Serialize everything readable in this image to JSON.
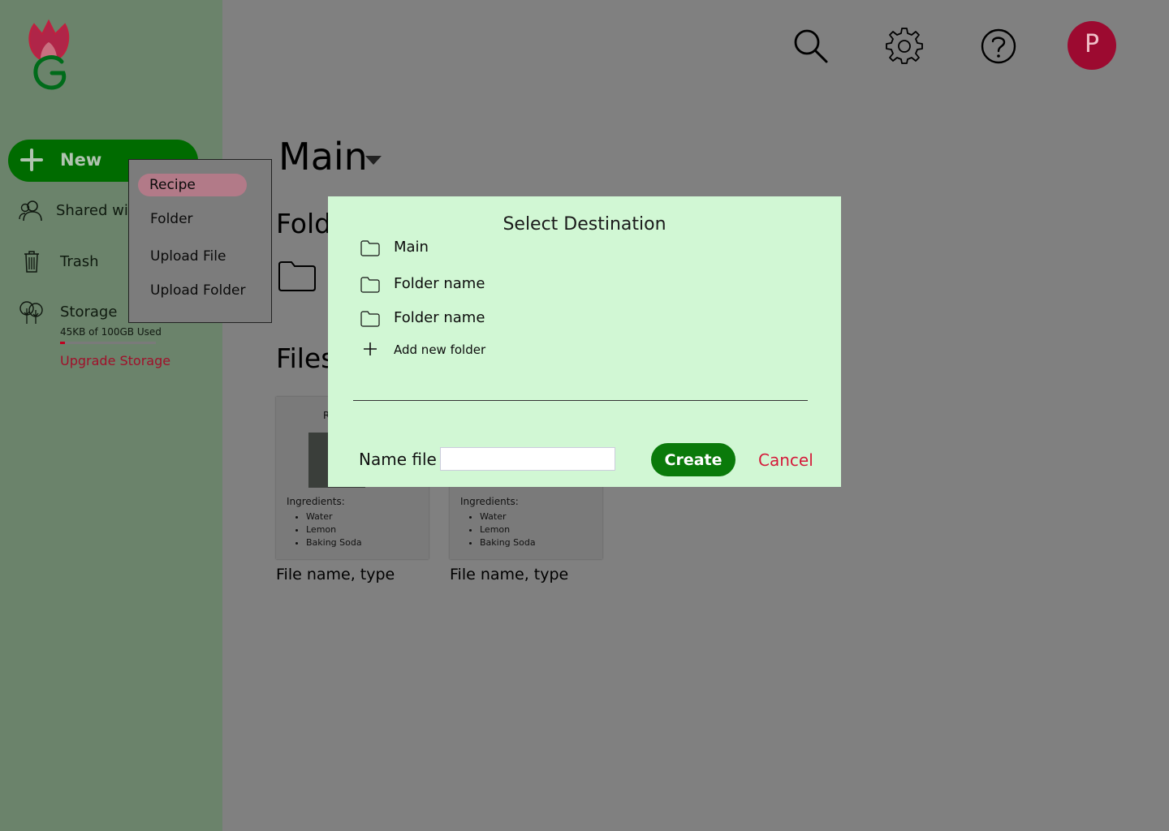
{
  "sidebar": {
    "new_label": "New",
    "items": [
      {
        "label": "Shared with me",
        "icon": "users-icon"
      },
      {
        "label": "Trash",
        "icon": "trash-icon"
      },
      {
        "label": "Storage",
        "icon": "trees-icon"
      }
    ],
    "storage": {
      "usage_text": "45KB of 100GB Used",
      "used_fraction": 0.05,
      "upgrade_label": "Upgrade Storage"
    }
  },
  "new_menu": {
    "items": [
      "Recipe",
      "Folder",
      "Upload File",
      "Upload Folder"
    ],
    "active": "Recipe"
  },
  "header": {
    "search_icon": "search-icon",
    "settings_icon": "gear-icon",
    "help_icon": "help-icon",
    "avatar_initial": "P"
  },
  "main": {
    "title": "Main",
    "folders_heading": "Folders",
    "files_heading": "Files",
    "cards": [
      {
        "title_initial": "R",
        "ingredients_label": "Ingredients:",
        "ingredients": [
          "Water",
          "Lemon",
          "Baking Soda"
        ],
        "caption": "File name, type"
      },
      {
        "title_initial": "",
        "ingredients_label": "Ingredients:",
        "ingredients": [
          "Water",
          "Lemon",
          "Baking Soda"
        ],
        "caption": "File name, type"
      }
    ]
  },
  "modal": {
    "title": "Select Destination",
    "destinations": [
      "Main",
      "Folder name",
      "Folder name"
    ],
    "add_folder_label": "Add new folder",
    "name_label": "Name file",
    "name_value": "",
    "create_label": "Create",
    "cancel_label": "Cancel"
  },
  "colors": {
    "sidebar_bg": "#6b836b",
    "overlay_bg": "#808080",
    "modal_bg": "#d1f7d4",
    "primary_green": "#0a7a0a",
    "cancel_red": "#d51a3a",
    "avatar_bg": "#9c0a30",
    "menu_active": "#b27a88"
  }
}
